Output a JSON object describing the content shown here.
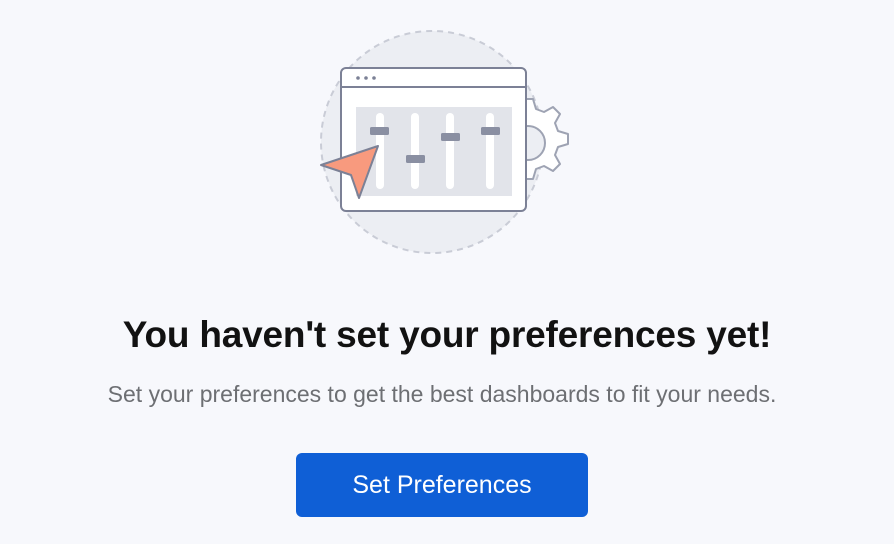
{
  "empty_state": {
    "illustration_icon": "preferences-sliders-illustration",
    "title": "You haven't set your preferences yet!",
    "description": "Set your preferences to get the best dashboards to fit your needs.",
    "button_label": "Set Preferences"
  },
  "colors": {
    "background": "#f7f8fc",
    "primary_button": "#0f5fd6",
    "title_text": "#121212",
    "body_text": "#6d6f73",
    "pointer_accent": "#f89a7e",
    "outline": "#7c8196"
  }
}
